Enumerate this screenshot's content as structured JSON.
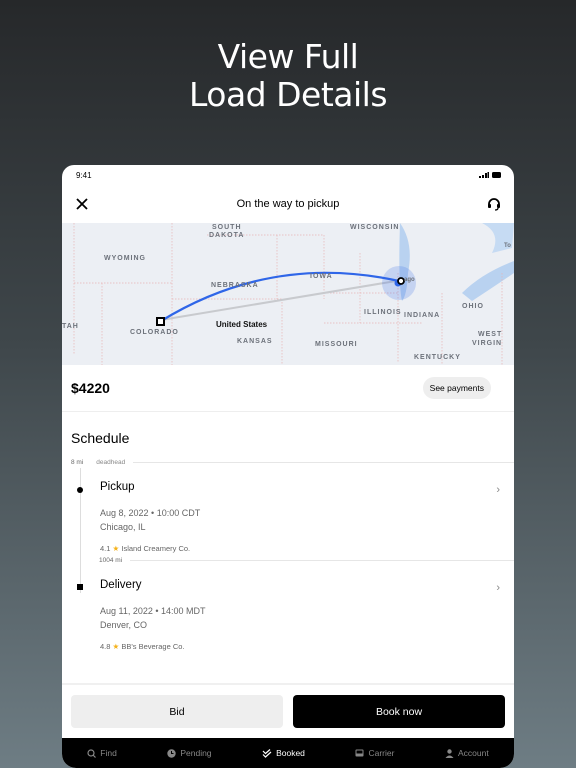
{
  "headline": {
    "line1": "View Full",
    "line2": "Load Details"
  },
  "status": {
    "time": "9:41"
  },
  "header": {
    "title": "On the way to pickup",
    "close_icon": "close-icon",
    "support_icon": "headset-icon"
  },
  "map": {
    "labels": [
      "SOUTH",
      "DAKOTA",
      "WISCONSIN",
      "WYOMING",
      "NEBRASKA",
      "IOWA",
      "ILLINOIS",
      "INDIANA",
      "OHIO",
      "COLORADO",
      "KANSAS",
      "MISSOURI",
      "KENTUCKY",
      "WEST",
      "VIRGIN",
      "TAH",
      "United States",
      "ago",
      "To"
    ],
    "route_color": "#2f66e8"
  },
  "price": {
    "amount": "$4220",
    "see_payments": "See payments"
  },
  "schedule": {
    "title": "Schedule",
    "deadhead": {
      "distance": "8 mi",
      "label": "deadhead"
    },
    "leg": {
      "distance": "1004 mi"
    },
    "stops": [
      {
        "type": "Pickup",
        "datetime": "Aug 8, 2022 • 10:00 CDT",
        "location": "Chicago, IL",
        "rating": "4.1",
        "company": "Island Creamery Co."
      },
      {
        "type": "Delivery",
        "datetime": "Aug 11, 2022 • 14:00 MDT",
        "location": "Denver, CO",
        "rating": "4.8",
        "company": "BB's Beverage Co."
      }
    ]
  },
  "actions": {
    "bid": "Bid",
    "book": "Book now"
  },
  "nav": [
    {
      "label": "Find",
      "icon": "search-icon"
    },
    {
      "label": "Pending",
      "icon": "clock-icon"
    },
    {
      "label": "Booked",
      "icon": "double-check-icon",
      "active": true
    },
    {
      "label": "Carrier",
      "icon": "truck-icon"
    },
    {
      "label": "Account",
      "icon": "person-icon"
    }
  ]
}
